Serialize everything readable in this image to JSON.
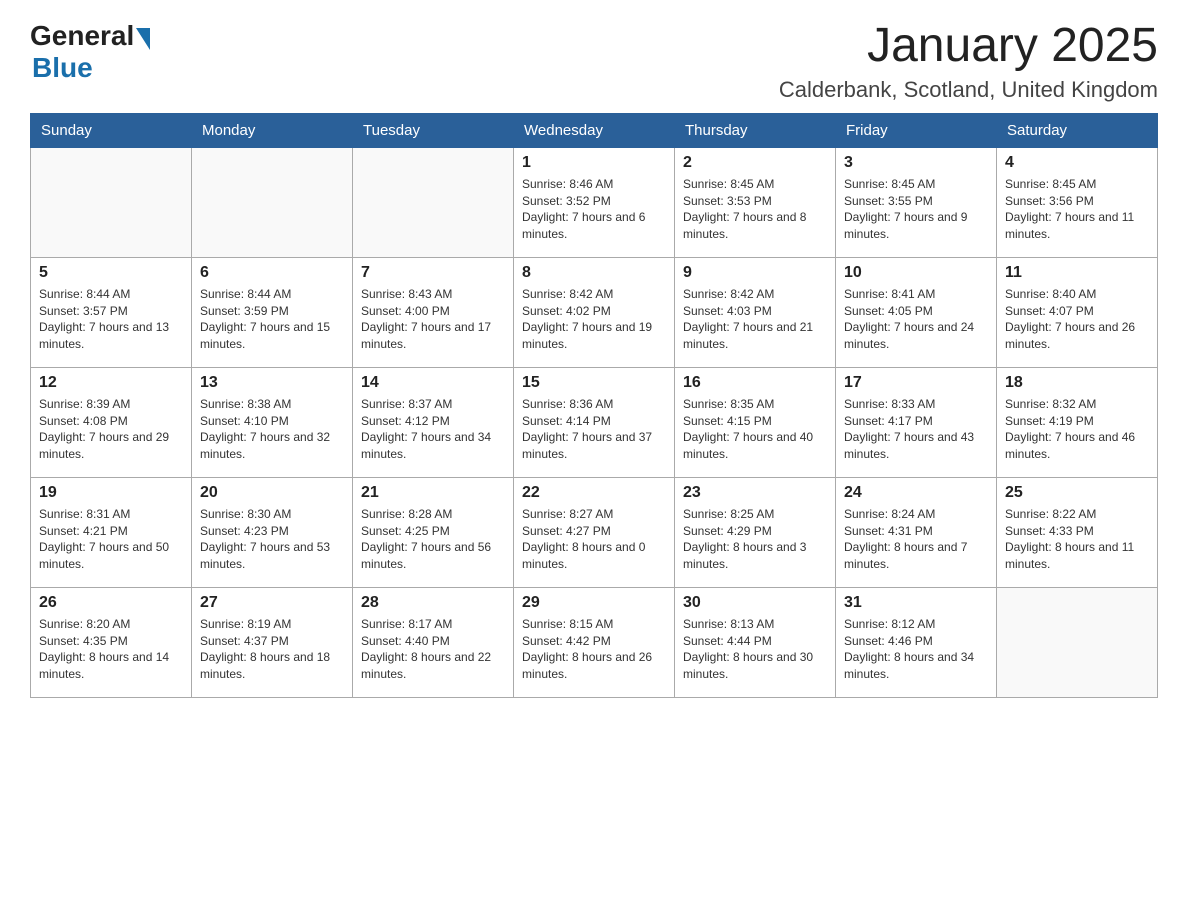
{
  "header": {
    "logo_general": "General",
    "logo_blue": "Blue",
    "title": "January 2025",
    "subtitle": "Calderbank, Scotland, United Kingdom"
  },
  "days_of_week": [
    "Sunday",
    "Monday",
    "Tuesday",
    "Wednesday",
    "Thursday",
    "Friday",
    "Saturday"
  ],
  "weeks": [
    [
      {
        "num": "",
        "info": ""
      },
      {
        "num": "",
        "info": ""
      },
      {
        "num": "",
        "info": ""
      },
      {
        "num": "1",
        "info": "Sunrise: 8:46 AM\nSunset: 3:52 PM\nDaylight: 7 hours and 6 minutes."
      },
      {
        "num": "2",
        "info": "Sunrise: 8:45 AM\nSunset: 3:53 PM\nDaylight: 7 hours and 8 minutes."
      },
      {
        "num": "3",
        "info": "Sunrise: 8:45 AM\nSunset: 3:55 PM\nDaylight: 7 hours and 9 minutes."
      },
      {
        "num": "4",
        "info": "Sunrise: 8:45 AM\nSunset: 3:56 PM\nDaylight: 7 hours and 11 minutes."
      }
    ],
    [
      {
        "num": "5",
        "info": "Sunrise: 8:44 AM\nSunset: 3:57 PM\nDaylight: 7 hours and 13 minutes."
      },
      {
        "num": "6",
        "info": "Sunrise: 8:44 AM\nSunset: 3:59 PM\nDaylight: 7 hours and 15 minutes."
      },
      {
        "num": "7",
        "info": "Sunrise: 8:43 AM\nSunset: 4:00 PM\nDaylight: 7 hours and 17 minutes."
      },
      {
        "num": "8",
        "info": "Sunrise: 8:42 AM\nSunset: 4:02 PM\nDaylight: 7 hours and 19 minutes."
      },
      {
        "num": "9",
        "info": "Sunrise: 8:42 AM\nSunset: 4:03 PM\nDaylight: 7 hours and 21 minutes."
      },
      {
        "num": "10",
        "info": "Sunrise: 8:41 AM\nSunset: 4:05 PM\nDaylight: 7 hours and 24 minutes."
      },
      {
        "num": "11",
        "info": "Sunrise: 8:40 AM\nSunset: 4:07 PM\nDaylight: 7 hours and 26 minutes."
      }
    ],
    [
      {
        "num": "12",
        "info": "Sunrise: 8:39 AM\nSunset: 4:08 PM\nDaylight: 7 hours and 29 minutes."
      },
      {
        "num": "13",
        "info": "Sunrise: 8:38 AM\nSunset: 4:10 PM\nDaylight: 7 hours and 32 minutes."
      },
      {
        "num": "14",
        "info": "Sunrise: 8:37 AM\nSunset: 4:12 PM\nDaylight: 7 hours and 34 minutes."
      },
      {
        "num": "15",
        "info": "Sunrise: 8:36 AM\nSunset: 4:14 PM\nDaylight: 7 hours and 37 minutes."
      },
      {
        "num": "16",
        "info": "Sunrise: 8:35 AM\nSunset: 4:15 PM\nDaylight: 7 hours and 40 minutes."
      },
      {
        "num": "17",
        "info": "Sunrise: 8:33 AM\nSunset: 4:17 PM\nDaylight: 7 hours and 43 minutes."
      },
      {
        "num": "18",
        "info": "Sunrise: 8:32 AM\nSunset: 4:19 PM\nDaylight: 7 hours and 46 minutes."
      }
    ],
    [
      {
        "num": "19",
        "info": "Sunrise: 8:31 AM\nSunset: 4:21 PM\nDaylight: 7 hours and 50 minutes."
      },
      {
        "num": "20",
        "info": "Sunrise: 8:30 AM\nSunset: 4:23 PM\nDaylight: 7 hours and 53 minutes."
      },
      {
        "num": "21",
        "info": "Sunrise: 8:28 AM\nSunset: 4:25 PM\nDaylight: 7 hours and 56 minutes."
      },
      {
        "num": "22",
        "info": "Sunrise: 8:27 AM\nSunset: 4:27 PM\nDaylight: 8 hours and 0 minutes."
      },
      {
        "num": "23",
        "info": "Sunrise: 8:25 AM\nSunset: 4:29 PM\nDaylight: 8 hours and 3 minutes."
      },
      {
        "num": "24",
        "info": "Sunrise: 8:24 AM\nSunset: 4:31 PM\nDaylight: 8 hours and 7 minutes."
      },
      {
        "num": "25",
        "info": "Sunrise: 8:22 AM\nSunset: 4:33 PM\nDaylight: 8 hours and 11 minutes."
      }
    ],
    [
      {
        "num": "26",
        "info": "Sunrise: 8:20 AM\nSunset: 4:35 PM\nDaylight: 8 hours and 14 minutes."
      },
      {
        "num": "27",
        "info": "Sunrise: 8:19 AM\nSunset: 4:37 PM\nDaylight: 8 hours and 18 minutes."
      },
      {
        "num": "28",
        "info": "Sunrise: 8:17 AM\nSunset: 4:40 PM\nDaylight: 8 hours and 22 minutes."
      },
      {
        "num": "29",
        "info": "Sunrise: 8:15 AM\nSunset: 4:42 PM\nDaylight: 8 hours and 26 minutes."
      },
      {
        "num": "30",
        "info": "Sunrise: 8:13 AM\nSunset: 4:44 PM\nDaylight: 8 hours and 30 minutes."
      },
      {
        "num": "31",
        "info": "Sunrise: 8:12 AM\nSunset: 4:46 PM\nDaylight: 8 hours and 34 minutes."
      },
      {
        "num": "",
        "info": ""
      }
    ]
  ]
}
